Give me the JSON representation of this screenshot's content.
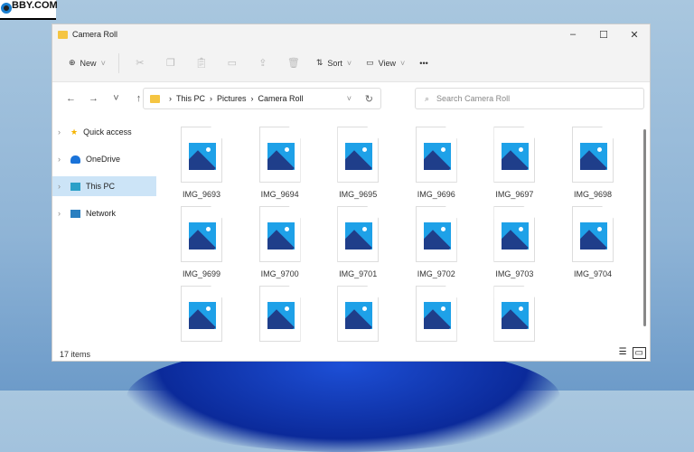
{
  "logo": {
    "text": "BBY.COM"
  },
  "window": {
    "title": "Camera Roll",
    "controls": [
      "–",
      "☐",
      "✕"
    ]
  },
  "commandbar": {
    "new": "New",
    "sort": "Sort",
    "view": "View",
    "more": "•••",
    "disabled_icons": [
      "cut",
      "copy",
      "paste",
      "rename",
      "share",
      "delete"
    ]
  },
  "nav": {
    "back": "←",
    "forward": "→",
    "recent": "˅",
    "up": "↑"
  },
  "address": {
    "crumbs": [
      "This PC",
      "Pictures",
      "Camera Roll"
    ]
  },
  "search": {
    "placeholder": "Search Camera Roll"
  },
  "sidebar": {
    "items": [
      {
        "label": "Quick access",
        "color": "#f5b400"
      },
      {
        "label": "OneDrive",
        "color": "#1a73d9"
      },
      {
        "label": "This PC",
        "color": "#2ba0c8"
      },
      {
        "label": "Network",
        "color": "#2a7fc0"
      }
    ]
  },
  "files": [
    "IMG_9693",
    "IMG_9694",
    "IMG_9695",
    "IMG_9696",
    "IMG_9697",
    "IMG_9698",
    "IMG_9699",
    "IMG_9700",
    "IMG_9701",
    "IMG_9702",
    "IMG_9703",
    "IMG_9704",
    "",
    "",
    "",
    "",
    ""
  ],
  "status": {
    "count": "17 items"
  }
}
